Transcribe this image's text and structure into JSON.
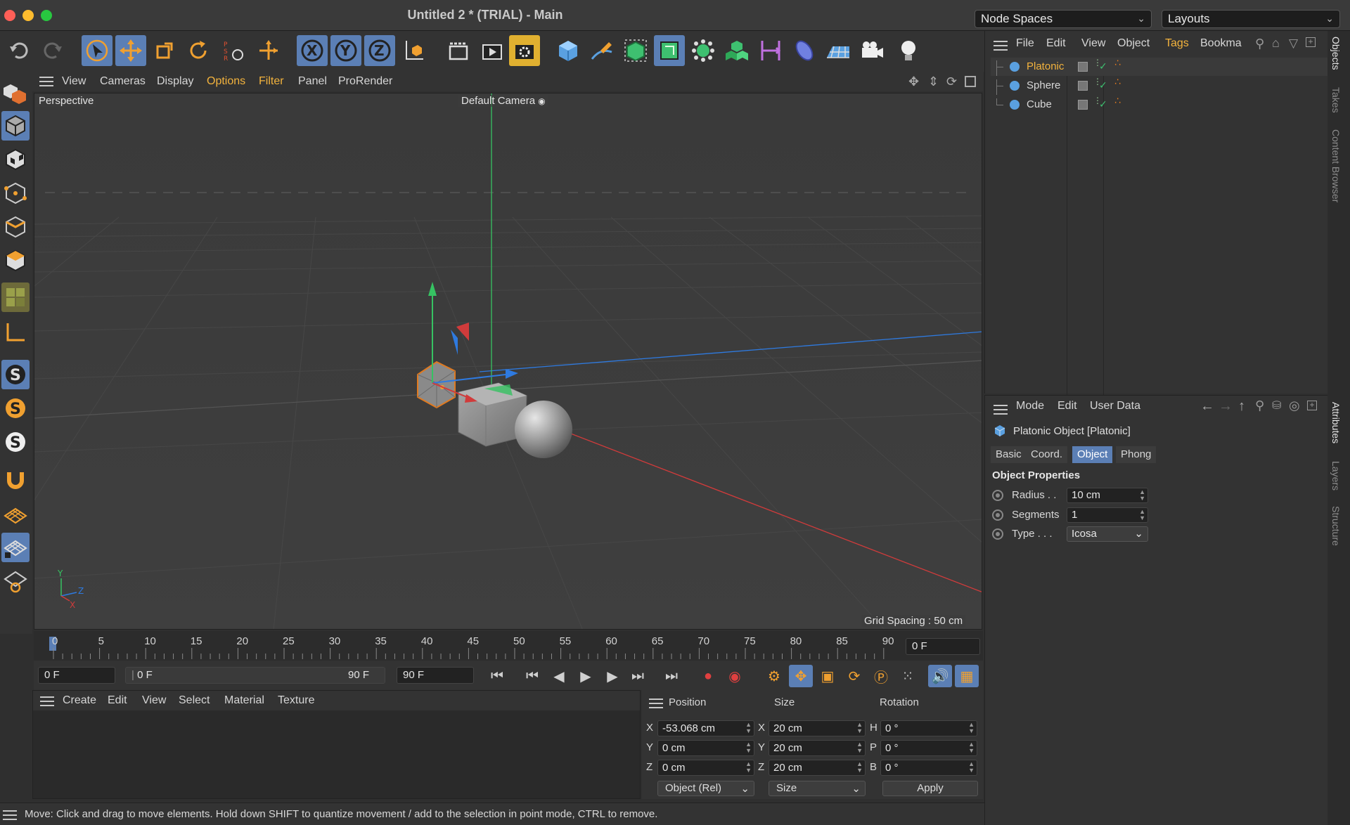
{
  "window": {
    "title": "Untitled 2 * (TRIAL) - Main",
    "node_spaces": "Node Spaces",
    "layouts": "Layouts"
  },
  "viewport": {
    "menu": [
      "View",
      "Cameras",
      "Display",
      "Options",
      "Filter",
      "Panel",
      "ProRender"
    ],
    "label_view": "Perspective",
    "label_camera": "Default Camera",
    "grid_spacing": "Grid Spacing : 50 cm",
    "axis_y": "Y",
    "axis_z": "Z",
    "axis_x": "X"
  },
  "timeline": {
    "ticks": [
      "0",
      "5",
      "10",
      "15",
      "20",
      "25",
      "30",
      "35",
      "40",
      "45",
      "50",
      "55",
      "60",
      "65",
      "70",
      "75",
      "80",
      "85",
      "90"
    ],
    "current_frame": "0 F",
    "start_frame": "0 F",
    "range_start": "0 F",
    "range_end": "90 F",
    "end_frame": "90 F"
  },
  "material_manager": {
    "menu": [
      "Create",
      "Edit",
      "View",
      "Select",
      "Material",
      "Texture"
    ]
  },
  "coordinates": {
    "headers": {
      "position": "Position",
      "size": "Size",
      "rotation": "Rotation"
    },
    "position": {
      "x": "-53.068 cm",
      "y": "0 cm",
      "z": "0 cm"
    },
    "size": {
      "x": "20 cm",
      "y": "20 cm",
      "z": "20 cm"
    },
    "rotation": {
      "h": "0 °",
      "p": "0 °",
      "b": "0 °"
    },
    "labels": {
      "x": "X",
      "y": "Y",
      "z": "Z",
      "h": "H",
      "p": "P",
      "b": "B"
    },
    "mode_select": "Object (Rel)",
    "size_select": "Size",
    "apply": "Apply"
  },
  "status": {
    "text": "Move: Click and drag to move elements. Hold down SHIFT to quantize movement / add to the selection in point mode, CTRL to remove."
  },
  "object_manager": {
    "menu": [
      "File",
      "Edit",
      "View",
      "Object",
      "Tags",
      "Bookma"
    ],
    "objects": [
      {
        "name": "Platonic",
        "selected": true
      },
      {
        "name": "Sphere",
        "selected": false
      },
      {
        "name": "Cube",
        "selected": false
      }
    ]
  },
  "attribute_manager": {
    "menu": [
      "Mode",
      "Edit",
      "User Data"
    ],
    "object_title": "Platonic Object [Platonic]",
    "tabs": [
      "Basic",
      "Coord.",
      "Object",
      "Phong"
    ],
    "active_tab": "Object",
    "section": "Object Properties",
    "props": [
      {
        "label": "Radius . .",
        "value": "10 cm"
      },
      {
        "label": "Segments",
        "value": "1"
      },
      {
        "label": "Type . . .",
        "value": "Icosa"
      }
    ]
  },
  "side_tabs": {
    "top": [
      "Objects",
      "Takes",
      "Content Browser"
    ],
    "bottom": [
      "Attributes",
      "Layers",
      "Structure"
    ]
  },
  "colors": {
    "accent": "#5b7fb5",
    "highlight": "#f3b33d",
    "axis_x": "#d13b3b",
    "axis_y": "#36c262",
    "axis_z": "#2e7ae0"
  }
}
